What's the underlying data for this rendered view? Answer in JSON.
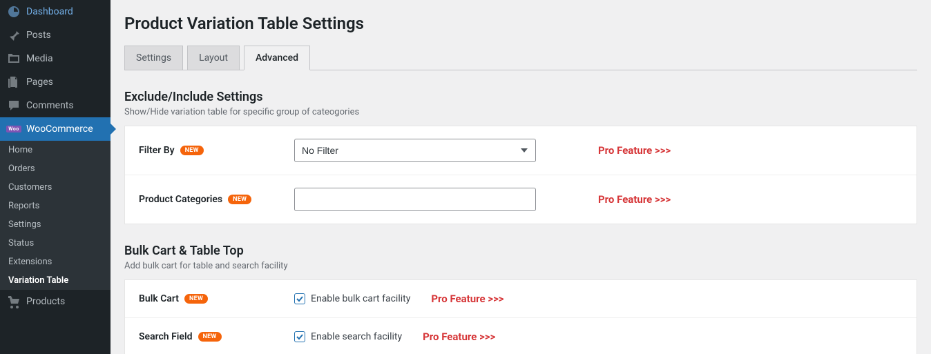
{
  "sidebar": {
    "items": [
      {
        "label": "Dashboard",
        "icon": "dashboard"
      },
      {
        "label": "Posts",
        "icon": "pin"
      },
      {
        "label": "Media",
        "icon": "media"
      },
      {
        "label": "Pages",
        "icon": "pages"
      },
      {
        "label": "Comments",
        "icon": "comments"
      },
      {
        "label": "WooCommerce",
        "icon": "woo",
        "active": true
      },
      {
        "label": "Products",
        "icon": "products"
      }
    ],
    "subitems": [
      {
        "label": "Home"
      },
      {
        "label": "Orders"
      },
      {
        "label": "Customers"
      },
      {
        "label": "Reports"
      },
      {
        "label": "Settings"
      },
      {
        "label": "Status"
      },
      {
        "label": "Extensions"
      },
      {
        "label": "Variation Table",
        "bold": true
      }
    ]
  },
  "page": {
    "title": "Product Variation Table Settings"
  },
  "tabs": [
    {
      "label": "Settings"
    },
    {
      "label": "Layout"
    },
    {
      "label": "Advanced",
      "active": true
    }
  ],
  "section1": {
    "title": "Exclude/Include Settings",
    "desc": "Show/Hide variation table for specific group of cateogories",
    "row1": {
      "label": "Filter By",
      "badge": "NEW",
      "value": "No Filter",
      "pro": "Pro Feature >>>"
    },
    "row2": {
      "label": "Product Categories",
      "badge": "NEW",
      "pro": "Pro Feature >>>"
    }
  },
  "section2": {
    "title": "Bulk Cart & Table Top",
    "desc": "Add bulk cart for table and search facility",
    "row1": {
      "label": "Bulk Cart",
      "badge": "NEW",
      "check_label": "Enable bulk cart facility",
      "pro": "Pro Feature >>>"
    },
    "row2": {
      "label": "Search Field",
      "badge": "NEW",
      "check_label": "Enable search facility",
      "pro": "Pro Feature >>>"
    }
  }
}
